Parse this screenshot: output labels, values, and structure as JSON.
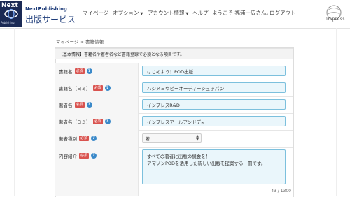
{
  "header": {
    "logo_text": "Next",
    "logo_subtext": "Publishing",
    "brand_en": "NextPublishing",
    "brand_jp": "出版サービス",
    "nav": [
      {
        "label": "マイページ",
        "dropdown": false
      },
      {
        "label": "オプション",
        "dropdown": true
      },
      {
        "label": "アカウント情報",
        "dropdown": true
      },
      {
        "label": "ヘルプ",
        "dropdown": false
      },
      {
        "label": "ようこそ 福浦一広さん。",
        "dropdown": false
      },
      {
        "label": "ログアウト",
        "dropdown": false
      }
    ],
    "impress_logo": "impress"
  },
  "breadcrumb": "マイページ > 書籍情報",
  "form": {
    "info_text": "【基本情報】書籍名や著者名など書籍登録で必須となる項目です。",
    "required_badge": "必須",
    "help_icon": "?",
    "fields": {
      "book_title": {
        "label": "書籍名",
        "value": "はじめよう！POD出版"
      },
      "book_title_kana": {
        "label": "書籍名（ヨミ）",
        "value": "ハジメヨウピーオーディーシュッパン"
      },
      "author": {
        "label": "著者名",
        "value": "インプレスR&D"
      },
      "author_kana": {
        "label": "著者名（ヨミ）",
        "value": "インプレスアールアンドディ"
      },
      "author_type": {
        "label": "著者種別",
        "value": "著"
      },
      "description": {
        "label": "内容紹介",
        "line1": "すべての著者に出版の機会を！",
        "line2": "アマゾンPODを活用した新しい出版を提案する一冊です。",
        "char_count": "43 / 1300"
      }
    }
  },
  "colors": {
    "brand": "#1f3d7a",
    "required": "#d9534f",
    "help": "#3a89c9",
    "input_bg": "#eaf6fb",
    "input_border": "#7cc0dd"
  }
}
